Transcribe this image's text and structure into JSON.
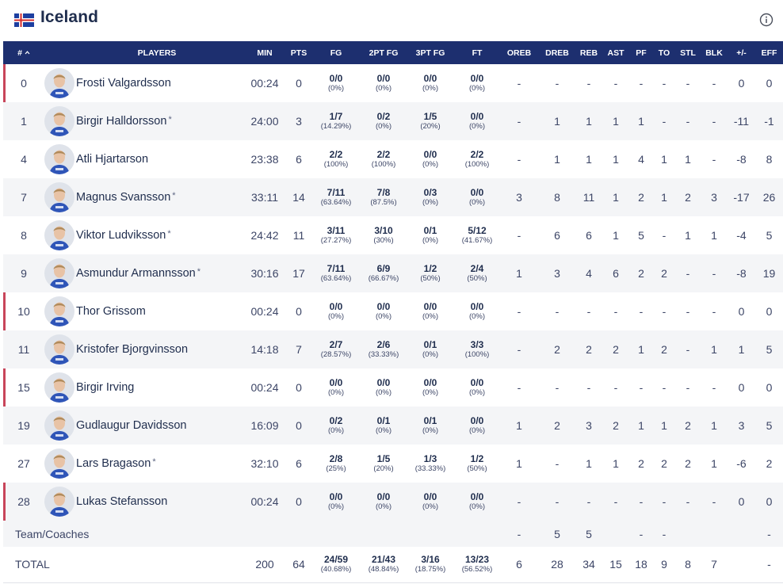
{
  "team": {
    "name": "Iceland",
    "flag_icon": "iceland-flag-icon",
    "flag_colors": {
      "field": "#1d3fa0",
      "cross_outer": "#ffffff",
      "cross_inner": "#d52b2b"
    },
    "info_icon": "info-icon"
  },
  "colors": {
    "header_bg": "#1d2f6f",
    "dnp_marker": "#c8455a",
    "stripe": "#f4f5f7",
    "text_dark": "#1f2d4d"
  },
  "columns": [
    "#",
    "PLAYERS",
    "MIN",
    "PTS",
    "FG",
    "2PT FG",
    "3PT FG",
    "FT",
    "OREB",
    "DREB",
    "REB",
    "AST",
    "PF",
    "TO",
    "STL",
    "BLK",
    "+/-",
    "EFF"
  ],
  "sort_icon": "sort-asc-icon",
  "players": [
    {
      "number": "0",
      "name": "Frosti Valgardsson",
      "starter": false,
      "dnp": true,
      "min": "00:24",
      "pts": "0",
      "fg": {
        "m": "0/0",
        "p": "(0%)"
      },
      "fg2": {
        "m": "0/0",
        "p": "(0%)"
      },
      "fg3": {
        "m": "0/0",
        "p": "(0%)"
      },
      "ft": {
        "m": "0/0",
        "p": "(0%)"
      },
      "oreb": "-",
      "dreb": "-",
      "reb": "-",
      "ast": "-",
      "pf": "-",
      "to": "-",
      "stl": "-",
      "blk": "-",
      "pm": "0",
      "eff": "0"
    },
    {
      "number": "1",
      "name": "Birgir Halldorsson",
      "starter": true,
      "dnp": false,
      "min": "24:00",
      "pts": "3",
      "fg": {
        "m": "1/7",
        "p": "(14.29%)"
      },
      "fg2": {
        "m": "0/2",
        "p": "(0%)"
      },
      "fg3": {
        "m": "1/5",
        "p": "(20%)"
      },
      "ft": {
        "m": "0/0",
        "p": "(0%)"
      },
      "oreb": "-",
      "dreb": "1",
      "reb": "1",
      "ast": "1",
      "pf": "1",
      "to": "-",
      "stl": "-",
      "blk": "-",
      "pm": "-11",
      "eff": "-1"
    },
    {
      "number": "4",
      "name": "Atli Hjartarson",
      "starter": false,
      "dnp": false,
      "min": "23:38",
      "pts": "6",
      "fg": {
        "m": "2/2",
        "p": "(100%)"
      },
      "fg2": {
        "m": "2/2",
        "p": "(100%)"
      },
      "fg3": {
        "m": "0/0",
        "p": "(0%)"
      },
      "ft": {
        "m": "2/2",
        "p": "(100%)"
      },
      "oreb": "-",
      "dreb": "1",
      "reb": "1",
      "ast": "1",
      "pf": "4",
      "to": "1",
      "stl": "1",
      "blk": "-",
      "pm": "-8",
      "eff": "8"
    },
    {
      "number": "7",
      "name": "Magnus Svansson",
      "starter": true,
      "dnp": false,
      "min": "33:11",
      "pts": "14",
      "fg": {
        "m": "7/11",
        "p": "(63.64%)"
      },
      "fg2": {
        "m": "7/8",
        "p": "(87.5%)"
      },
      "fg3": {
        "m": "0/3",
        "p": "(0%)"
      },
      "ft": {
        "m": "0/0",
        "p": "(0%)"
      },
      "oreb": "3",
      "dreb": "8",
      "reb": "11",
      "ast": "1",
      "pf": "2",
      "to": "1",
      "stl": "2",
      "blk": "3",
      "pm": "-17",
      "eff": "26"
    },
    {
      "number": "8",
      "name": "Viktor Ludviksson",
      "starter": true,
      "dnp": false,
      "min": "24:42",
      "pts": "11",
      "fg": {
        "m": "3/11",
        "p": "(27.27%)"
      },
      "fg2": {
        "m": "3/10",
        "p": "(30%)"
      },
      "fg3": {
        "m": "0/1",
        "p": "(0%)"
      },
      "ft": {
        "m": "5/12",
        "p": "(41.67%)"
      },
      "oreb": "-",
      "dreb": "6",
      "reb": "6",
      "ast": "1",
      "pf": "5",
      "to": "-",
      "stl": "1",
      "blk": "1",
      "pm": "-4",
      "eff": "5"
    },
    {
      "number": "9",
      "name": "Asmundur Armannsson",
      "starter": true,
      "dnp": false,
      "min": "30:16",
      "pts": "17",
      "fg": {
        "m": "7/11",
        "p": "(63.64%)"
      },
      "fg2": {
        "m": "6/9",
        "p": "(66.67%)"
      },
      "fg3": {
        "m": "1/2",
        "p": "(50%)"
      },
      "ft": {
        "m": "2/4",
        "p": "(50%)"
      },
      "oreb": "1",
      "dreb": "3",
      "reb": "4",
      "ast": "6",
      "pf": "2",
      "to": "2",
      "stl": "-",
      "blk": "-",
      "pm": "-8",
      "eff": "19"
    },
    {
      "number": "10",
      "name": "Thor Grissom",
      "starter": false,
      "dnp": true,
      "min": "00:24",
      "pts": "0",
      "fg": {
        "m": "0/0",
        "p": "(0%)"
      },
      "fg2": {
        "m": "0/0",
        "p": "(0%)"
      },
      "fg3": {
        "m": "0/0",
        "p": "(0%)"
      },
      "ft": {
        "m": "0/0",
        "p": "(0%)"
      },
      "oreb": "-",
      "dreb": "-",
      "reb": "-",
      "ast": "-",
      "pf": "-",
      "to": "-",
      "stl": "-",
      "blk": "-",
      "pm": "0",
      "eff": "0"
    },
    {
      "number": "11",
      "name": "Kristofer Bjorgvinsson",
      "starter": false,
      "dnp": false,
      "min": "14:18",
      "pts": "7",
      "fg": {
        "m": "2/7",
        "p": "(28.57%)"
      },
      "fg2": {
        "m": "2/6",
        "p": "(33.33%)"
      },
      "fg3": {
        "m": "0/1",
        "p": "(0%)"
      },
      "ft": {
        "m": "3/3",
        "p": "(100%)"
      },
      "oreb": "-",
      "dreb": "2",
      "reb": "2",
      "ast": "2",
      "pf": "1",
      "to": "2",
      "stl": "-",
      "blk": "1",
      "pm": "1",
      "eff": "5"
    },
    {
      "number": "15",
      "name": "Birgir Irving",
      "starter": false,
      "dnp": true,
      "min": "00:24",
      "pts": "0",
      "fg": {
        "m": "0/0",
        "p": "(0%)"
      },
      "fg2": {
        "m": "0/0",
        "p": "(0%)"
      },
      "fg3": {
        "m": "0/0",
        "p": "(0%)"
      },
      "ft": {
        "m": "0/0",
        "p": "(0%)"
      },
      "oreb": "-",
      "dreb": "-",
      "reb": "-",
      "ast": "-",
      "pf": "-",
      "to": "-",
      "stl": "-",
      "blk": "-",
      "pm": "0",
      "eff": "0"
    },
    {
      "number": "19",
      "name": "Gudlaugur Davidsson",
      "starter": false,
      "dnp": false,
      "min": "16:09",
      "pts": "0",
      "fg": {
        "m": "0/2",
        "p": "(0%)"
      },
      "fg2": {
        "m": "0/1",
        "p": "(0%)"
      },
      "fg3": {
        "m": "0/1",
        "p": "(0%)"
      },
      "ft": {
        "m": "0/0",
        "p": "(0%)"
      },
      "oreb": "1",
      "dreb": "2",
      "reb": "3",
      "ast": "2",
      "pf": "1",
      "to": "1",
      "stl": "2",
      "blk": "1",
      "pm": "3",
      "eff": "5"
    },
    {
      "number": "27",
      "name": "Lars Bragason",
      "starter": true,
      "dnp": false,
      "min": "32:10",
      "pts": "6",
      "fg": {
        "m": "2/8",
        "p": "(25%)"
      },
      "fg2": {
        "m": "1/5",
        "p": "(20%)"
      },
      "fg3": {
        "m": "1/3",
        "p": "(33.33%)"
      },
      "ft": {
        "m": "1/2",
        "p": "(50%)"
      },
      "oreb": "1",
      "dreb": "-",
      "reb": "1",
      "ast": "1",
      "pf": "2",
      "to": "2",
      "stl": "2",
      "blk": "1",
      "pm": "-6",
      "eff": "2"
    },
    {
      "number": "28",
      "name": "Lukas Stefansson",
      "starter": false,
      "dnp": true,
      "min": "00:24",
      "pts": "0",
      "fg": {
        "m": "0/0",
        "p": "(0%)"
      },
      "fg2": {
        "m": "0/0",
        "p": "(0%)"
      },
      "fg3": {
        "m": "0/0",
        "p": "(0%)"
      },
      "ft": {
        "m": "0/0",
        "p": "(0%)"
      },
      "oreb": "-",
      "dreb": "-",
      "reb": "-",
      "ast": "-",
      "pf": "-",
      "to": "-",
      "stl": "-",
      "blk": "-",
      "pm": "0",
      "eff": "0"
    }
  ],
  "starter_mark": "*",
  "team_row": {
    "label": "Team/Coaches",
    "oreb": "-",
    "dreb": "5",
    "reb": "5",
    "pf": "-",
    "to": "-",
    "eff": "-"
  },
  "total_row": {
    "label": "TOTAL",
    "min": "200",
    "pts": "64",
    "fg": {
      "m": "24/59",
      "p": "(40.68%)"
    },
    "fg2": {
      "m": "21/43",
      "p": "(48.84%)"
    },
    "fg3": {
      "m": "3/16",
      "p": "(18.75%)"
    },
    "ft": {
      "m": "13/23",
      "p": "(56.52%)"
    },
    "oreb": "6",
    "dreb": "28",
    "reb": "34",
    "ast": "15",
    "pf": "18",
    "to": "9",
    "stl": "8",
    "blk": "7",
    "pm": "",
    "eff": "-"
  }
}
